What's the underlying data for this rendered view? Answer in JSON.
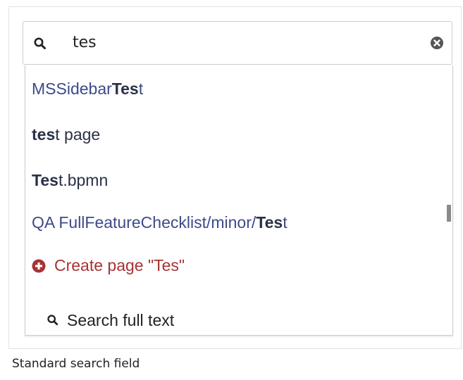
{
  "search": {
    "value": "tes",
    "icon": "search-icon",
    "clear_icon": "clear-icon"
  },
  "suggestions": [
    {
      "pre": "MSSidebar",
      "match": "Tes",
      "post": "t"
    },
    {
      "pre": "",
      "match": "tes",
      "post": "t page"
    },
    {
      "pre": "",
      "match": "Tes",
      "post": "t.bpmn"
    },
    {
      "pre": "QA FullFeatureChecklist/minor/",
      "match": "Tes",
      "post": "t"
    }
  ],
  "create": {
    "label": "Create page \"Tes\"",
    "icon": "plus-circle-icon",
    "color": "#a83234"
  },
  "fulltext": {
    "label": "Search full text",
    "icon": "search-icon"
  },
  "caption": "Standard search field",
  "colors": {
    "link": "#3d4a8a",
    "text": "#222222",
    "border": "#c8ccd1"
  }
}
